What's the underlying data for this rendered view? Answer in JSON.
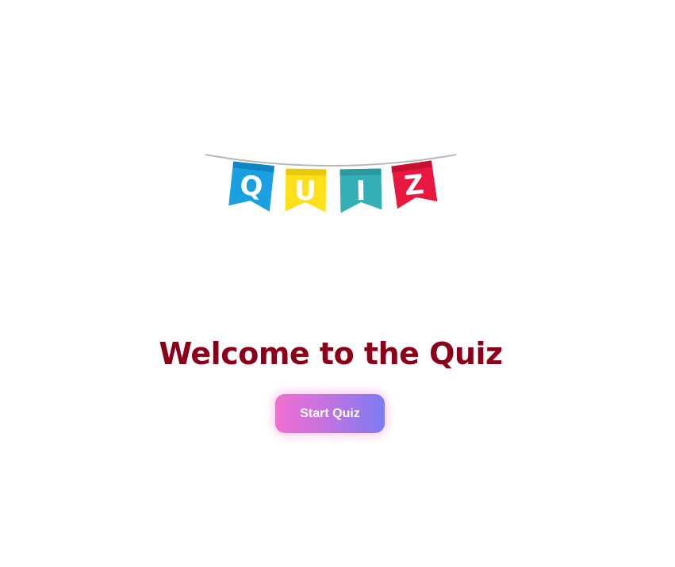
{
  "banner": {
    "letters": [
      "Q",
      "U",
      "I",
      "Z"
    ],
    "colors": [
      "#1a9fe0",
      "#fde01a",
      "#34afb6",
      "#e8173f"
    ],
    "icon": "quiz-bunting-banner"
  },
  "main": {
    "title": "Welcome to the Quiz",
    "start_label": "Start Quiz"
  },
  "colors": {
    "title": "#8b0018",
    "button_gradient_start": "#f06fcf",
    "button_gradient_end": "#7b7cf4"
  }
}
